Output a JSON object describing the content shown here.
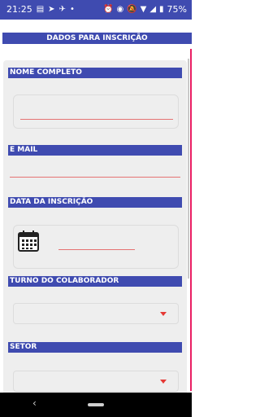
{
  "status": {
    "time": "21:25",
    "battery": "75%",
    "icons_left": [
      "sms-icon",
      "navigation-icon",
      "telegram-icon",
      "dot-icon"
    ],
    "icons_right": [
      "alarm-icon",
      "eye-icon",
      "mute-icon",
      "wifi-icon",
      "signal-icon",
      "battery-icon"
    ]
  },
  "header": {
    "title": "DADOS PARA INSCRIÇÃO"
  },
  "form": {
    "nome_label": "NOME COMPLETO",
    "nome_value": "",
    "email_label": "E MAIL",
    "email_value": "",
    "data_label": "DATA DA INSCRIÇÃO",
    "data_value": "",
    "turno_label": "TURNO DO COLABORADOR",
    "turno_value": "",
    "setor_label": "SETOR",
    "setor_value": ""
  },
  "colors": {
    "accent": "#3f4bb0",
    "underline": "#e57373",
    "caret": "#e53935",
    "edge": "#e91e63"
  }
}
